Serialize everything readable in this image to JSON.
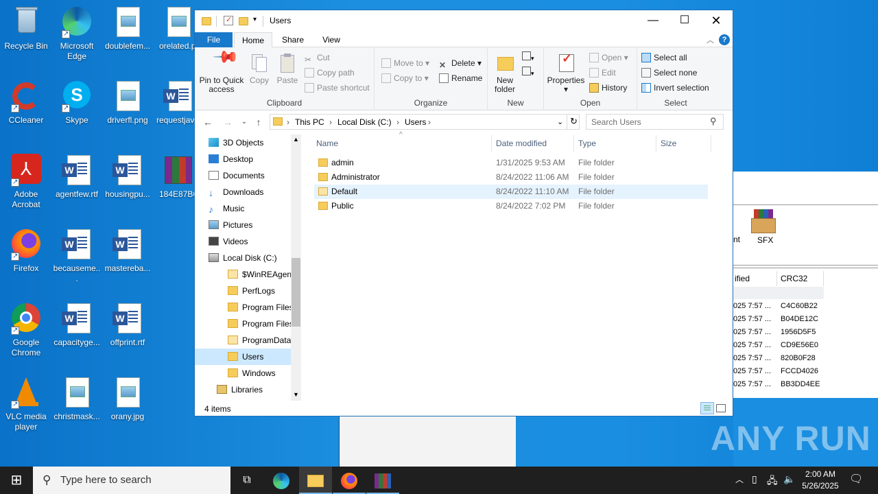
{
  "desktop": {
    "icons": [
      {
        "label": "Recycle Bin"
      },
      {
        "label": "Microsoft Edge"
      },
      {
        "label": "doublefem..."
      },
      {
        "label": "orelated.p"
      },
      {
        "label": "CCleaner"
      },
      {
        "label": "Skype"
      },
      {
        "label": "driverfl.png"
      },
      {
        "label": "requestjav"
      },
      {
        "label": "Adobe Acrobat"
      },
      {
        "label": "agentfew.rtf"
      },
      {
        "label": "housingpu..."
      },
      {
        "label": "184E87B6-"
      },
      {
        "label": "Firefox"
      },
      {
        "label": "becauseme..."
      },
      {
        "label": "mastereba..."
      },
      {
        "label": "Google Chrome"
      },
      {
        "label": "capacityge..."
      },
      {
        "label": "offprint.rtf"
      },
      {
        "label": "VLC media player"
      },
      {
        "label": "christmask..."
      },
      {
        "label": "orany.jpg"
      }
    ]
  },
  "bg_winrar": {
    "toolbar_partial": "nt",
    "sfx_label": "SFX",
    "col_modified": "ified",
    "col_crc": "CRC32",
    "rows": [
      {
        "date": "025 7:57 ...",
        "crc": "C4C60B22"
      },
      {
        "date": "025 7:57 ...",
        "crc": "B04DE12C"
      },
      {
        "date": "025 7:57 ...",
        "crc": "1956D5F5"
      },
      {
        "date": "025 7:57 ...",
        "crc": "CD9E56E0"
      },
      {
        "date": "025 7:57 ...",
        "crc": "820B0F28"
      },
      {
        "date": "025 7:57 ...",
        "crc": "FCCD4026"
      },
      {
        "date": "025 7:57 ...",
        "crc": "BB3DD4EE"
      }
    ]
  },
  "explorer": {
    "title": "Users",
    "tabs": {
      "file": "File",
      "home": "Home",
      "share": "Share",
      "view": "View"
    },
    "ribbon": {
      "clipboard": {
        "label": "Clipboard",
        "pin": "Pin to Quick access",
        "copy": "Copy",
        "paste": "Paste",
        "cut": "Cut",
        "copy_path": "Copy path",
        "paste_shortcut": "Paste shortcut"
      },
      "organize": {
        "label": "Organize",
        "move_to": "Move to",
        "copy_to": "Copy to",
        "delete": "Delete",
        "rename": "Rename"
      },
      "new": {
        "label": "New",
        "new_folder": "New folder"
      },
      "open": {
        "label": "Open",
        "properties": "Properties",
        "open": "Open",
        "edit": "Edit",
        "history": "History"
      },
      "select": {
        "label": "Select",
        "select_all": "Select all",
        "select_none": "Select none",
        "invert": "Invert selection"
      }
    },
    "address": {
      "crumbs": [
        "This PC",
        "Local Disk (C:)",
        "Users"
      ]
    },
    "search_placeholder": "Search Users",
    "nav": [
      {
        "label": "3D Objects",
        "indent": 1
      },
      {
        "label": "Desktop",
        "indent": 1
      },
      {
        "label": "Documents",
        "indent": 1
      },
      {
        "label": "Downloads",
        "indent": 1
      },
      {
        "label": "Music",
        "indent": 1
      },
      {
        "label": "Pictures",
        "indent": 1
      },
      {
        "label": "Videos",
        "indent": 1
      },
      {
        "label": "Local Disk (C:)",
        "indent": 1
      },
      {
        "label": "$WinREAgent",
        "indent": 2
      },
      {
        "label": "PerfLogs",
        "indent": 2
      },
      {
        "label": "Program Files",
        "indent": 2
      },
      {
        "label": "Program Files",
        "indent": 2
      },
      {
        "label": "ProgramData",
        "indent": 2
      },
      {
        "label": "Users",
        "indent": 2
      },
      {
        "label": "Windows",
        "indent": 2
      },
      {
        "label": "Libraries",
        "indent": 0
      }
    ],
    "columns": {
      "name": "Name",
      "date": "Date modified",
      "type": "Type",
      "size": "Size"
    },
    "files": [
      {
        "name": "admin",
        "date": "1/31/2025 9:53 AM",
        "type": "File folder"
      },
      {
        "name": "Administrator",
        "date": "8/24/2022 11:06 AM",
        "type": "File folder"
      },
      {
        "name": "Default",
        "date": "8/24/2022 11:10 AM",
        "type": "File folder"
      },
      {
        "name": "Public",
        "date": "8/24/2022 7:02 PM",
        "type": "File folder"
      }
    ],
    "status": "4 items"
  },
  "taskbar": {
    "search_placeholder": "Type here to search",
    "time": "2:00 AM",
    "date": "5/26/2025"
  },
  "watermark": "ANY RUN",
  "colors": {
    "accent": "#1979ca",
    "desktop": "#1a8ee0",
    "selection": "#cce8ff"
  }
}
